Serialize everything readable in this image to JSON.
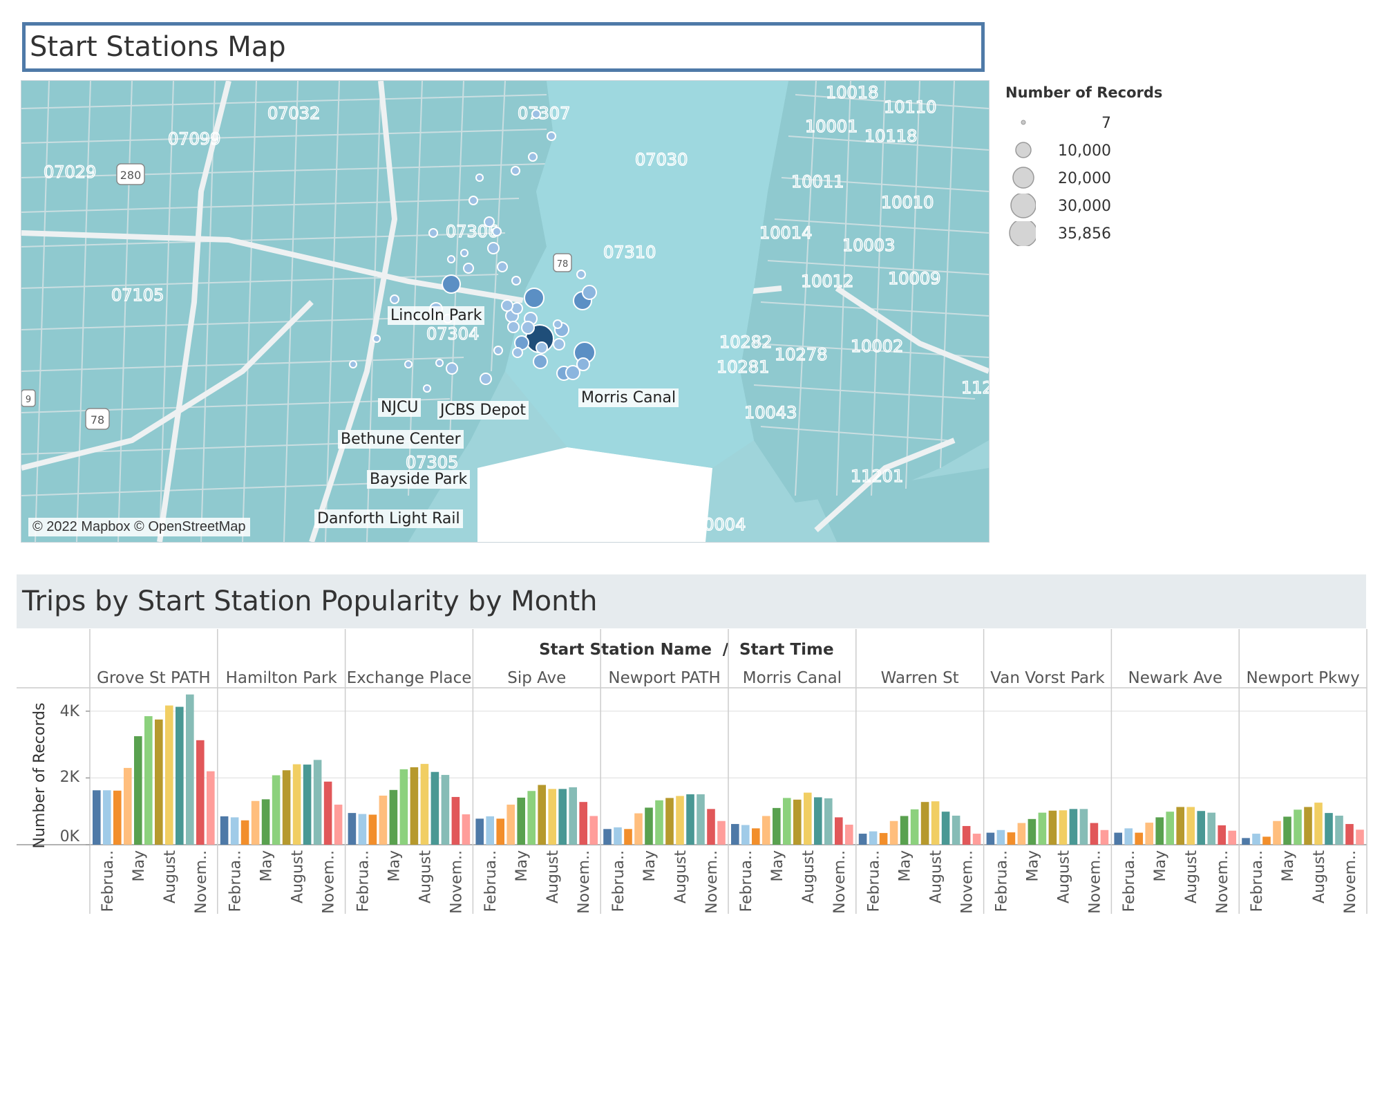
{
  "map": {
    "title": "Start Stations Map",
    "attribution": "© 2022 Mapbox © OpenStreetMap",
    "labels": {
      "lincoln_park": "Lincoln Park",
      "morris_canal": "Morris Canal",
      "njcu": "NJCU",
      "jcbs_depot": "JCBS Depot",
      "bethune_center": "Bethune Center",
      "bayside_park": "Bayside Park",
      "danforth": "Danforth Light Rail"
    },
    "zipcodes": [
      "07032",
      "07307",
      "07099",
      "07029",
      "07030",
      "07306",
      "07310",
      "07105",
      "07304",
      "07305",
      "10018",
      "10110",
      "10001",
      "10118",
      "10011",
      "10010",
      "10014",
      "10003",
      "10012",
      "10009",
      "10282",
      "10278",
      "10002",
      "10281",
      "10043",
      "11201",
      "10004",
      "112"
    ],
    "shields": [
      "280",
      "78",
      "78",
      "9"
    ],
    "colors": {
      "water": "#9fd4da",
      "land": "#8ec9cf",
      "road": "#e2e6e8",
      "station_light": "#9cc0e4",
      "station_mid": "#5b8fc4",
      "station_dark": "#1f4e79"
    }
  },
  "legend": {
    "title": "Number of Records",
    "items": [
      "7",
      "10,000",
      "20,000",
      "30,000",
      "35,856"
    ]
  },
  "bar_section": {
    "title": "Trips by Start Station Popularity by Month",
    "header_station": "Start Station Name",
    "header_sep": "/",
    "header_time": "Start Time",
    "ylabel": "Number of Records",
    "y_ticks": [
      "0K",
      "2K",
      "4K"
    ]
  },
  "chart_data": {
    "type": "bar",
    "title": "Trips by Start Station Popularity by Month",
    "ylabel": "Number of Records",
    "ylim": [
      0,
      4700
    ],
    "x_tick_labels": [
      "Februa..",
      "May",
      "August",
      "Novem.."
    ],
    "month_colors": [
      "#4e79a7",
      "#a0cbe8",
      "#f28e2b",
      "#ffbe7d",
      "#59a14f",
      "#8cd17d",
      "#b6992d",
      "#f1ce63",
      "#499894",
      "#86bcb6",
      "#e15759",
      "#ff9d9a"
    ],
    "stations": [
      {
        "name": "Grove St PATH",
        "values": [
          1630,
          1630,
          1620,
          2300,
          3250,
          3850,
          3750,
          4170,
          4130,
          4500,
          3130,
          2200
        ]
      },
      {
        "name": "Hamilton Park",
        "values": [
          850,
          820,
          730,
          1310,
          1360,
          2080,
          2230,
          2410,
          2400,
          2540,
          1890,
          1200
        ]
      },
      {
        "name": "Exchange Place",
        "values": [
          950,
          920,
          900,
          1470,
          1640,
          2260,
          2320,
          2420,
          2180,
          2090,
          1430,
          910
        ]
      },
      {
        "name": "Sip Ave",
        "values": [
          780,
          850,
          780,
          1200,
          1410,
          1610,
          1790,
          1670,
          1670,
          1720,
          1280,
          860
        ]
      },
      {
        "name": "Newport PATH",
        "values": [
          470,
          520,
          470,
          940,
          1110,
          1330,
          1400,
          1460,
          1510,
          1510,
          1070,
          710
        ]
      },
      {
        "name": "Morris Canal",
        "values": [
          620,
          590,
          490,
          860,
          1100,
          1400,
          1350,
          1560,
          1420,
          1390,
          820,
          600
        ]
      },
      {
        "name": "Warren St",
        "values": [
          330,
          400,
          350,
          710,
          860,
          1060,
          1280,
          1300,
          990,
          870,
          560,
          330
        ]
      },
      {
        "name": "Van Vorst Park",
        "values": [
          360,
          440,
          370,
          650,
          770,
          960,
          1020,
          1030,
          1070,
          1070,
          650,
          440
        ]
      },
      {
        "name": "Newark Ave",
        "values": [
          360,
          490,
          360,
          660,
          820,
          990,
          1130,
          1130,
          1010,
          960,
          580,
          420
        ]
      },
      {
        "name": "Newport Pkwy",
        "values": [
          200,
          330,
          240,
          710,
          840,
          1050,
          1130,
          1260,
          950,
          870,
          620,
          450
        ]
      }
    ]
  }
}
